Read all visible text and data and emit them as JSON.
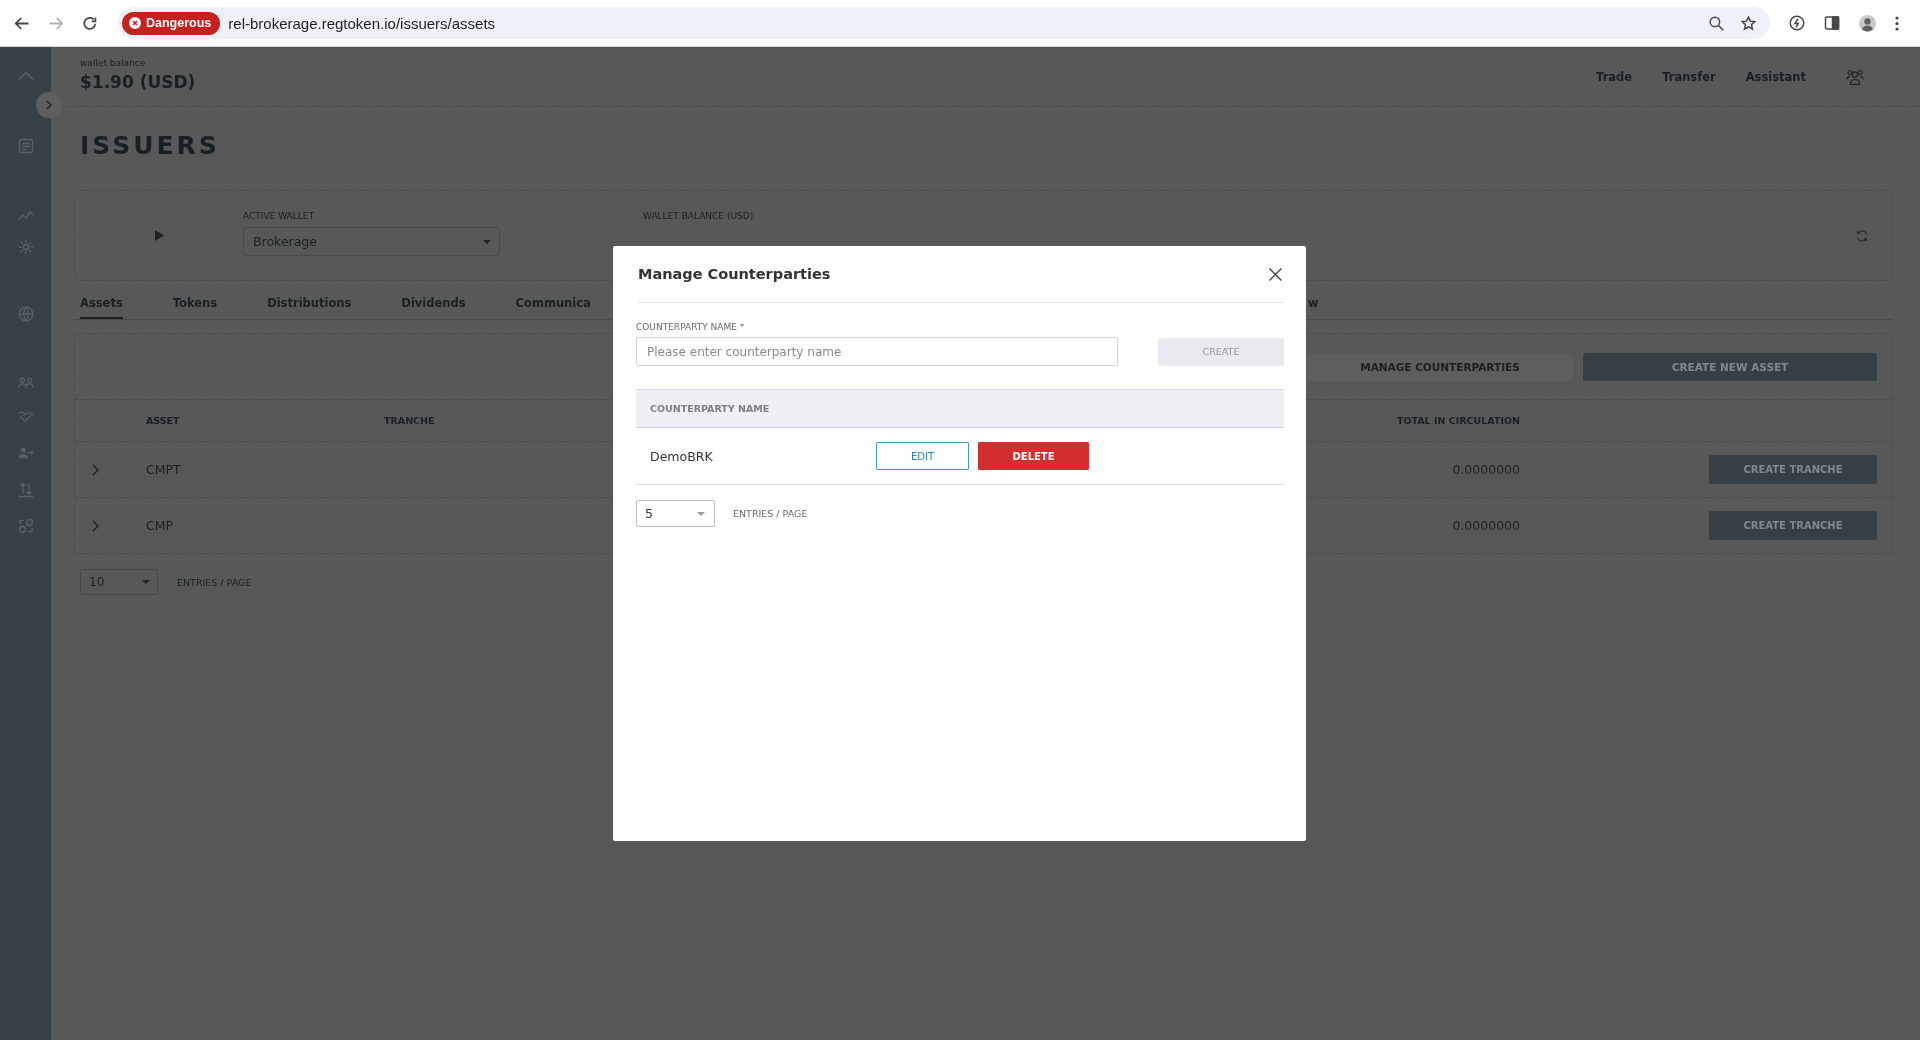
{
  "browser": {
    "nav_buttons": [
      {
        "kind": "back",
        "disabled": false
      },
      {
        "kind": "forward",
        "disabled": true
      },
      {
        "kind": "reload",
        "disabled": false
      }
    ],
    "security_chip": "Dangerous",
    "url": "rel-brokerage.regtoken.io/issuers/assets"
  },
  "header": {
    "balance_label": "wallet balance",
    "balance": "$1.90 (USD)",
    "nav": [
      "Trade",
      "Transfer",
      "Assistant"
    ]
  },
  "page_title": "ISSUERS",
  "wallet_card": {
    "active_wallet_label": "ACTIVE WALLET",
    "active_wallet": "Brokerage",
    "balance_label": "WALLET BALANCE (USD)"
  },
  "tabs": [
    {
      "label": "Assets",
      "selected": true
    },
    {
      "label": "Tokens",
      "selected": false
    },
    {
      "label": "Distributions",
      "selected": false
    },
    {
      "label": "Dividends",
      "selected": false
    },
    {
      "label": "Communica",
      "selected": false
    },
    {
      "label": "w",
      "selected": false
    }
  ],
  "assets_panel": {
    "toolbar": [
      {
        "label": "MANAGE COUNTERPARTIES",
        "disabled": true
      },
      {
        "label": "CREATE NEW ASSET",
        "disabled": false
      }
    ],
    "columns": [
      "ASSET",
      "TRANCHE",
      "TOTAL IN CIRCULATION"
    ],
    "rows": [
      {
        "asset": "CMPT",
        "total": "0.0000000",
        "action": "CREATE TRANCHE",
        "expanded": false
      },
      {
        "asset": "CMP",
        "total": "0.0000000",
        "action": "CREATE TRANCHE",
        "expanded": false
      }
    ],
    "pagination": {
      "page_size": "10",
      "label": "ENTRIES / PAGE"
    }
  },
  "modal": {
    "title": "Manage Counterparties",
    "field": {
      "label": "COUNTERPARTY NAME *",
      "placeholder": "Please enter counterparty name"
    },
    "create_button": {
      "label": "CREATE",
      "disabled": true
    },
    "table": {
      "columns": [
        "COUNTERPARTY NAME"
      ],
      "rows": [
        {
          "name": "DemoBRK",
          "actions": [
            {
              "kind": "edit",
              "label": "EDIT"
            },
            {
              "kind": "delete",
              "label": "DELETE"
            }
          ]
        }
      ]
    },
    "pagination": {
      "page_size": "5",
      "label": "ENTRIES / PAGE"
    }
  }
}
